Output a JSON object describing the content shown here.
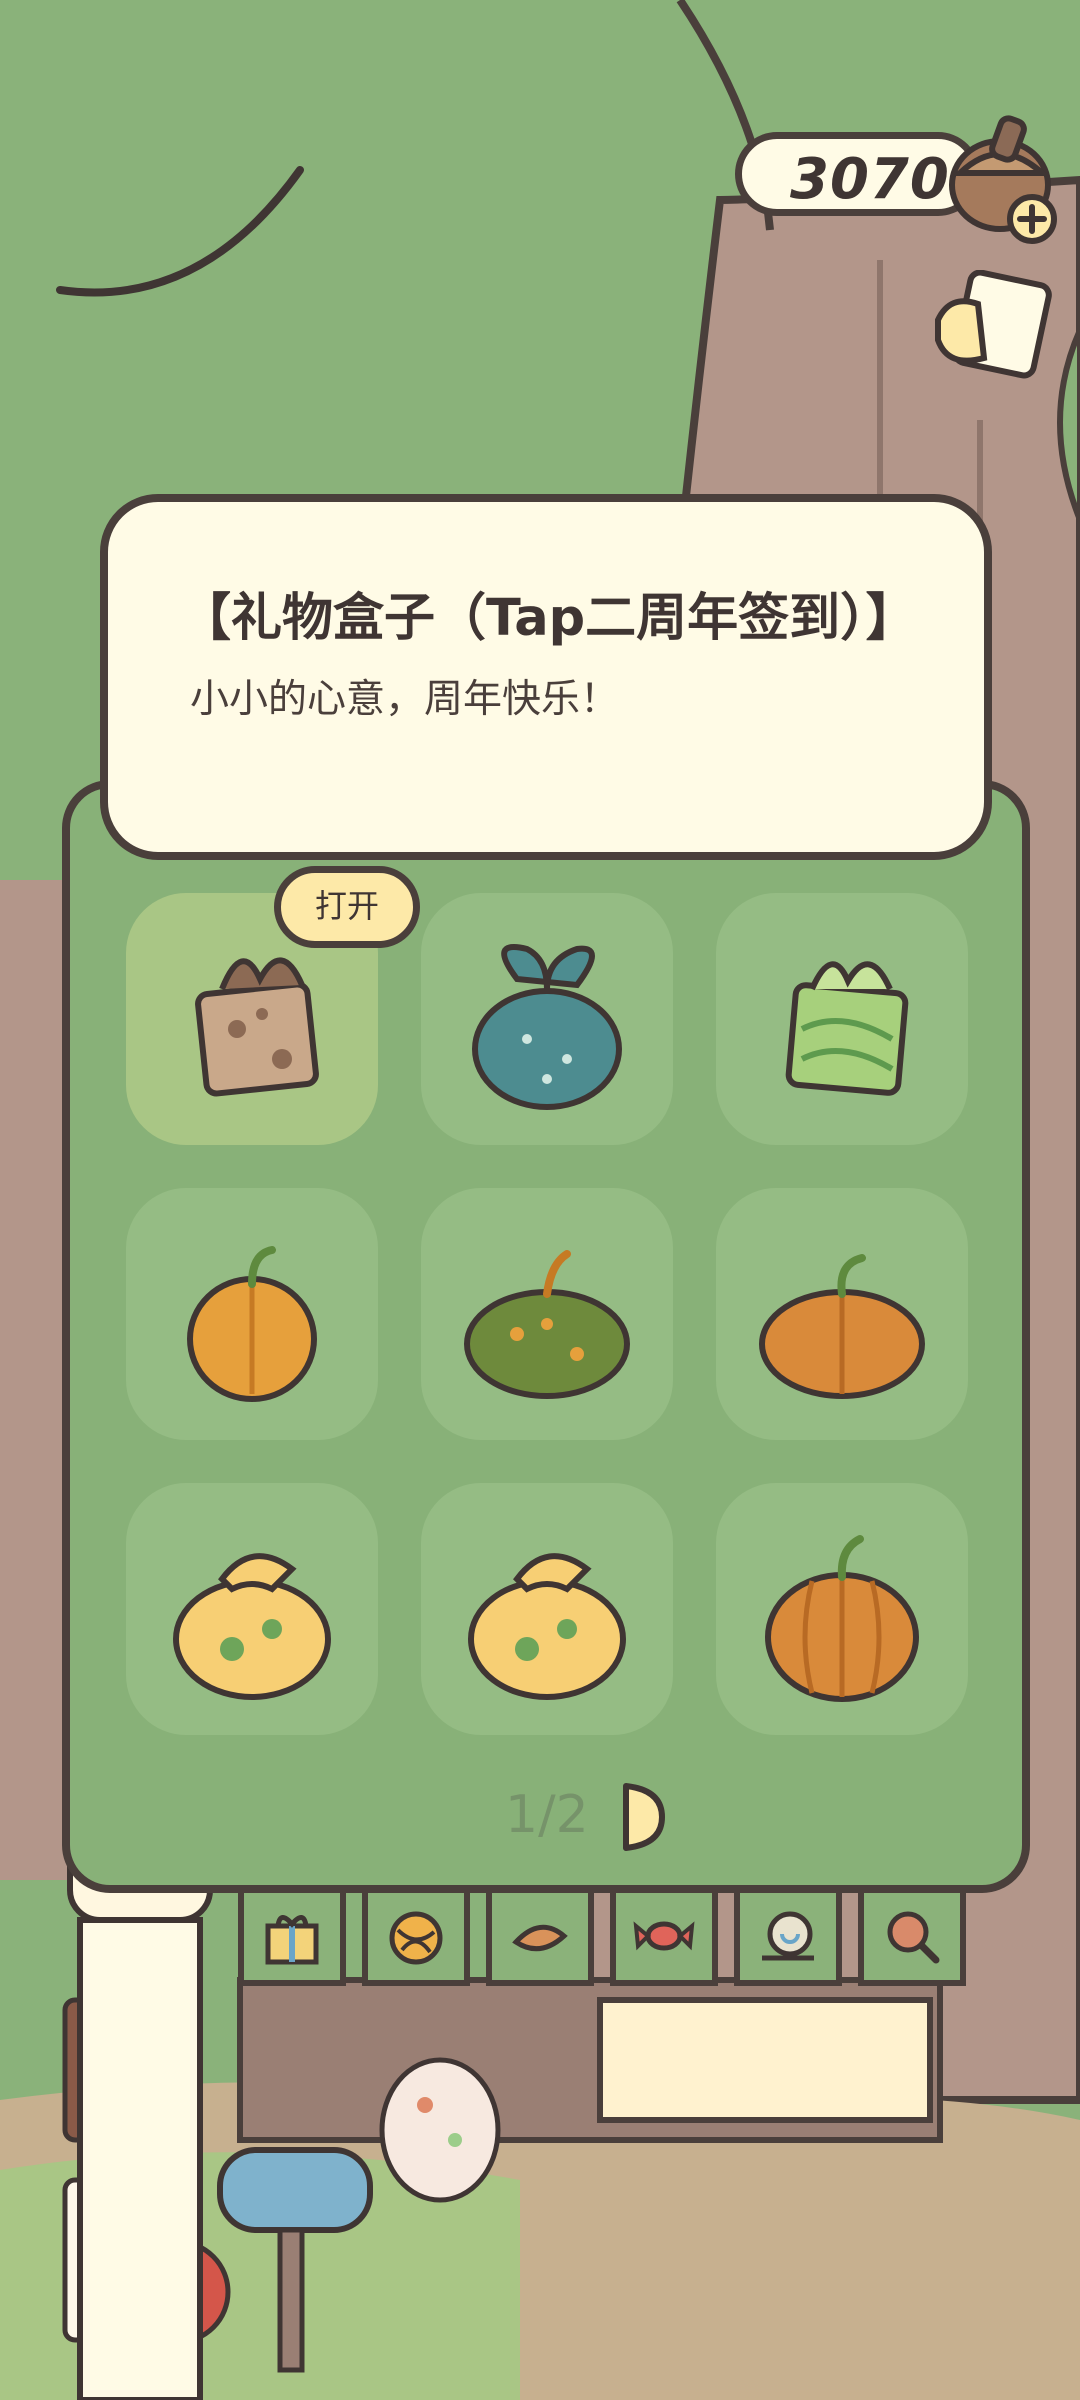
{
  "currency": {
    "amount": "3070"
  },
  "item_info": {
    "title": "【礼物盒子（Tap二周年签到）】",
    "description": "小小的心意，周年快乐！"
  },
  "open_button": {
    "label": "打开"
  },
  "pager": {
    "text": "1/2"
  },
  "grid_items": [
    {
      "icon": "gift-box-leopard-icon",
      "selected": true
    },
    {
      "icon": "bundle-bag-teal-icon"
    },
    {
      "icon": "gift-box-green-icon"
    },
    {
      "icon": "pumpkin-yellow-icon"
    },
    {
      "icon": "pumpkin-green-icon"
    },
    {
      "icon": "pumpkin-orange-icon"
    },
    {
      "icon": "clover-pouch-icon"
    },
    {
      "icon": "clover-pouch-icon"
    },
    {
      "icon": "pumpkin-orange-large-icon"
    }
  ],
  "tabs": [
    {
      "icon": "gift-icon"
    },
    {
      "icon": "yarn-ball-icon"
    },
    {
      "icon": "leaf-icon"
    },
    {
      "icon": "candy-icon"
    },
    {
      "icon": "snail-icon"
    },
    {
      "icon": "magnifier-icon"
    }
  ]
}
